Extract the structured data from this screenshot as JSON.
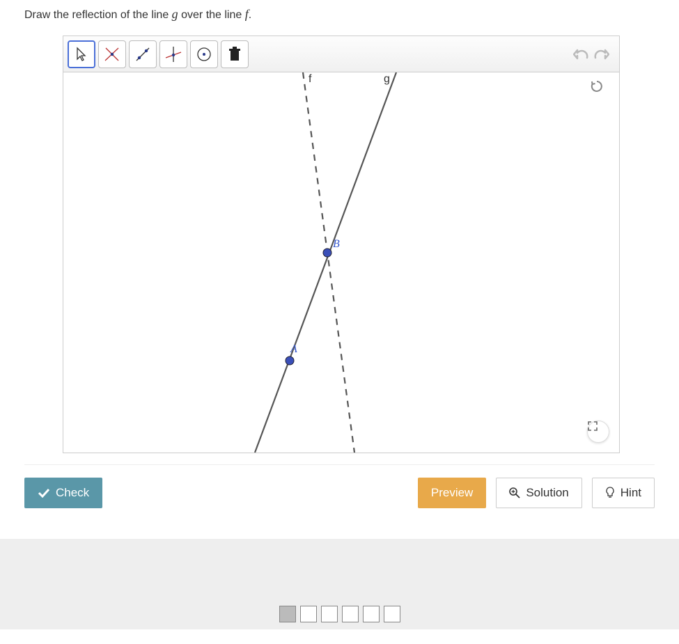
{
  "instruction": {
    "pre": "Draw the reflection of the line ",
    "g": "g",
    "mid": " over the line ",
    "f": "f",
    "post": "."
  },
  "tools": {
    "select_name": "select",
    "intersect_name": "intersect",
    "segment_name": "segment",
    "ray_name": "ray",
    "circle_name": "circle",
    "delete_name": "delete"
  },
  "graph": {
    "label_f": "f",
    "label_g": "g",
    "point_A": "A",
    "point_B": "B"
  },
  "buttons": {
    "check": "Check",
    "preview": "Preview",
    "solution": "Solution",
    "hint": "Hint"
  },
  "nav": {
    "total": 6,
    "current": 1
  }
}
